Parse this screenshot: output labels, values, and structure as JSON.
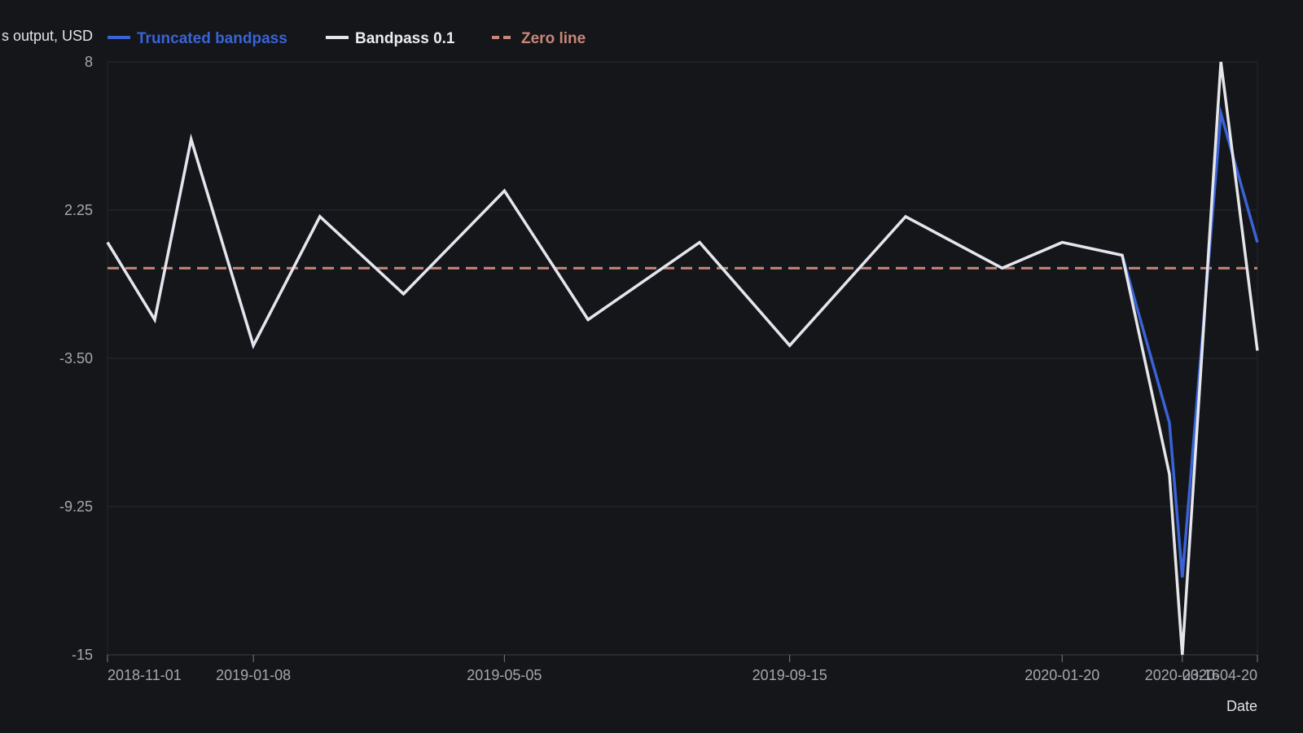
{
  "chart_data": {
    "type": "line",
    "xlabel": "Date",
    "ylabel": "s output, USD",
    "x_ticks": [
      "2018-11-01",
      "2019-01-08",
      "2019-05-05",
      "2019-09-15",
      "2020-01-20",
      "2020-03-16",
      "2020-04-20"
    ],
    "y_ticks": [
      8,
      2.25,
      -3.5,
      -9.25,
      -15
    ],
    "y_tick_labels": [
      "8",
      "2.25",
      "-3.50",
      "-9.25",
      "-15"
    ],
    "ylim": [
      -15,
      8
    ],
    "xlim": [
      "2018-11-01",
      "2020-04-20"
    ],
    "grid": true,
    "legend_position": "top",
    "series": [
      {
        "name": "Truncated bandpass",
        "color": "#3a63d6",
        "style": "solid",
        "points": [
          [
            "2018-11-01",
            1.0
          ],
          [
            "2018-11-23",
            -2.0
          ],
          [
            "2018-12-10",
            5.0
          ],
          [
            "2019-01-08",
            -3.0
          ],
          [
            "2019-02-08",
            2.0
          ],
          [
            "2019-03-19",
            -1.0
          ],
          [
            "2019-05-05",
            3.0
          ],
          [
            "2019-06-13",
            -2.0
          ],
          [
            "2019-08-04",
            1.0
          ],
          [
            "2019-09-15",
            -3.0
          ],
          [
            "2019-11-08",
            2.0
          ],
          [
            "2019-12-23",
            0.0
          ],
          [
            "2020-01-20",
            1.0
          ],
          [
            "2020-02-17",
            0.5
          ],
          [
            "2020-03-10",
            -6.0
          ],
          [
            "2020-03-16",
            -12.0
          ],
          [
            "2020-04-03",
            6.0
          ],
          [
            "2020-04-20",
            1.0
          ]
        ]
      },
      {
        "name": "Bandpass 0.1",
        "color": "#e6e6ea",
        "style": "solid",
        "points": [
          [
            "2018-11-01",
            1.0
          ],
          [
            "2018-11-23",
            -2.0
          ],
          [
            "2018-12-10",
            5.0
          ],
          [
            "2019-01-08",
            -3.0
          ],
          [
            "2019-02-08",
            2.0
          ],
          [
            "2019-03-19",
            -1.0
          ],
          [
            "2019-05-05",
            3.0
          ],
          [
            "2019-06-13",
            -2.0
          ],
          [
            "2019-08-04",
            1.0
          ],
          [
            "2019-09-15",
            -3.0
          ],
          [
            "2019-11-08",
            2.0
          ],
          [
            "2019-12-23",
            0.0
          ],
          [
            "2020-01-20",
            1.0
          ],
          [
            "2020-02-17",
            0.5
          ],
          [
            "2020-03-10",
            -8.0
          ],
          [
            "2020-03-16",
            -15.0
          ],
          [
            "2020-04-03",
            8.0
          ],
          [
            "2020-04-20",
            -3.2
          ]
        ]
      },
      {
        "name": "Zero line",
        "color": "#c98678",
        "style": "dashed",
        "points": [
          [
            "2018-11-01",
            0
          ],
          [
            "2020-04-20",
            0
          ]
        ]
      }
    ]
  }
}
